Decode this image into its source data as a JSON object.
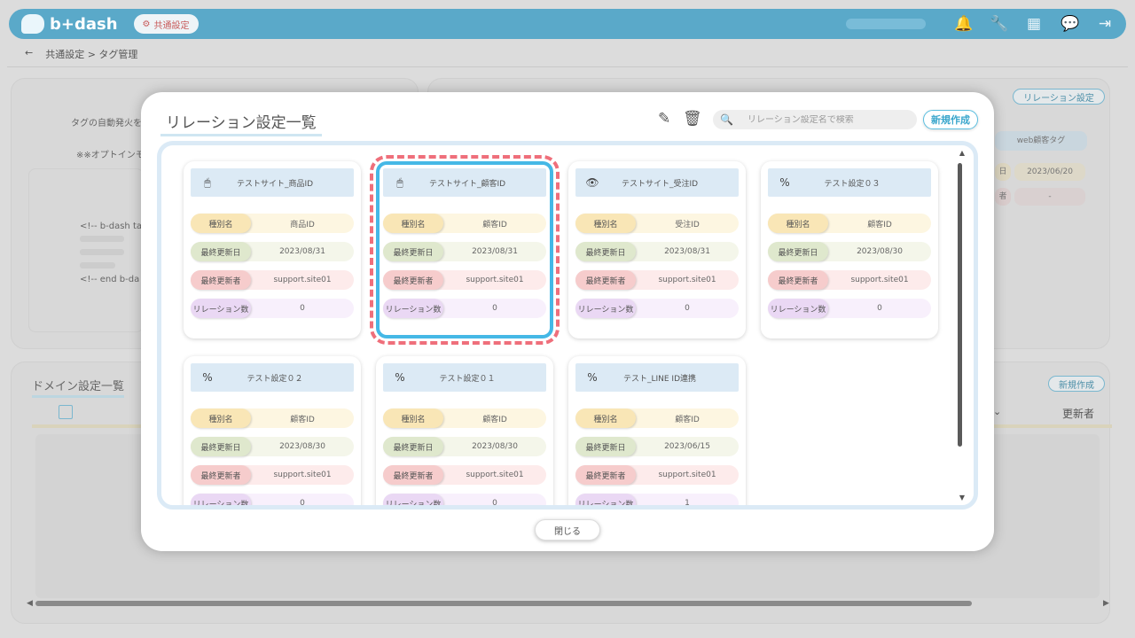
{
  "app": {
    "logo_text": "b+dash",
    "shared_badge": "共通設定"
  },
  "breadcrumb": {
    "back": "←",
    "path": "共通設定 > タグ管理"
  },
  "background": {
    "auto_fire_text": "タグの自動発火を",
    "option_text": "※※オプトインモ",
    "code_lines": [
      "<!-- b-dash ta",
      "<!-- end b-da"
    ],
    "relation_button": "リレーション設定",
    "web_tag_header": "web顧客タグ",
    "web_tag_date": "2023/06/20",
    "web_tag_user": "-",
    "web_tag_date_label": "日",
    "web_tag_user_label": "者",
    "domain_heading": "ドメイン設定一覧",
    "domain_new_button": "新規作成",
    "updater_column": "更新者"
  },
  "modal": {
    "title": "リレーション設定一覧",
    "search_placeholder": "リレーション設定名で検索",
    "new_button": "新規作成",
    "close_button": "閉じる",
    "labels": {
      "type": "種別名",
      "updated": "最終更新日",
      "updater": "最終更新者",
      "count": "リレーション数"
    },
    "cards": [
      {
        "name": "テストサイト_商品ID",
        "icon": "mouse-icon",
        "glyph": "🖱",
        "type": "商品ID",
        "updated": "2023/08/31",
        "updater": "support.site01",
        "count": "0"
      },
      {
        "name": "テストサイト_顧客ID",
        "icon": "mouse-icon",
        "glyph": "🖱",
        "type": "顧客ID",
        "updated": "2023/08/31",
        "updater": "support.site01",
        "count": "0"
      },
      {
        "name": "テストサイト_受注ID",
        "icon": "eye-icon",
        "glyph": "👁",
        "type": "受注ID",
        "updated": "2023/08/31",
        "updater": "support.site01",
        "count": "0"
      },
      {
        "name": "テスト設定０３",
        "icon": "percent-icon",
        "glyph": "%",
        "type": "顧客ID",
        "updated": "2023/08/30",
        "updater": "support.site01",
        "count": "0"
      },
      {
        "name": "テスト設定０２",
        "icon": "percent-icon",
        "glyph": "%",
        "type": "顧客ID",
        "updated": "2023/08/30",
        "updater": "support.site01",
        "count": "0"
      },
      {
        "name": "テスト設定０１",
        "icon": "percent-icon",
        "glyph": "%",
        "type": "顧客ID",
        "updated": "2023/08/30",
        "updater": "support.site01",
        "count": "0"
      },
      {
        "name": "テスト_LINE ID連携",
        "icon": "percent-icon",
        "glyph": "%",
        "type": "顧客ID",
        "updated": "2023/06/15",
        "updater": "support.site01",
        "count": "1"
      }
    ],
    "selected_card": "テストサイト_顧客ID"
  }
}
